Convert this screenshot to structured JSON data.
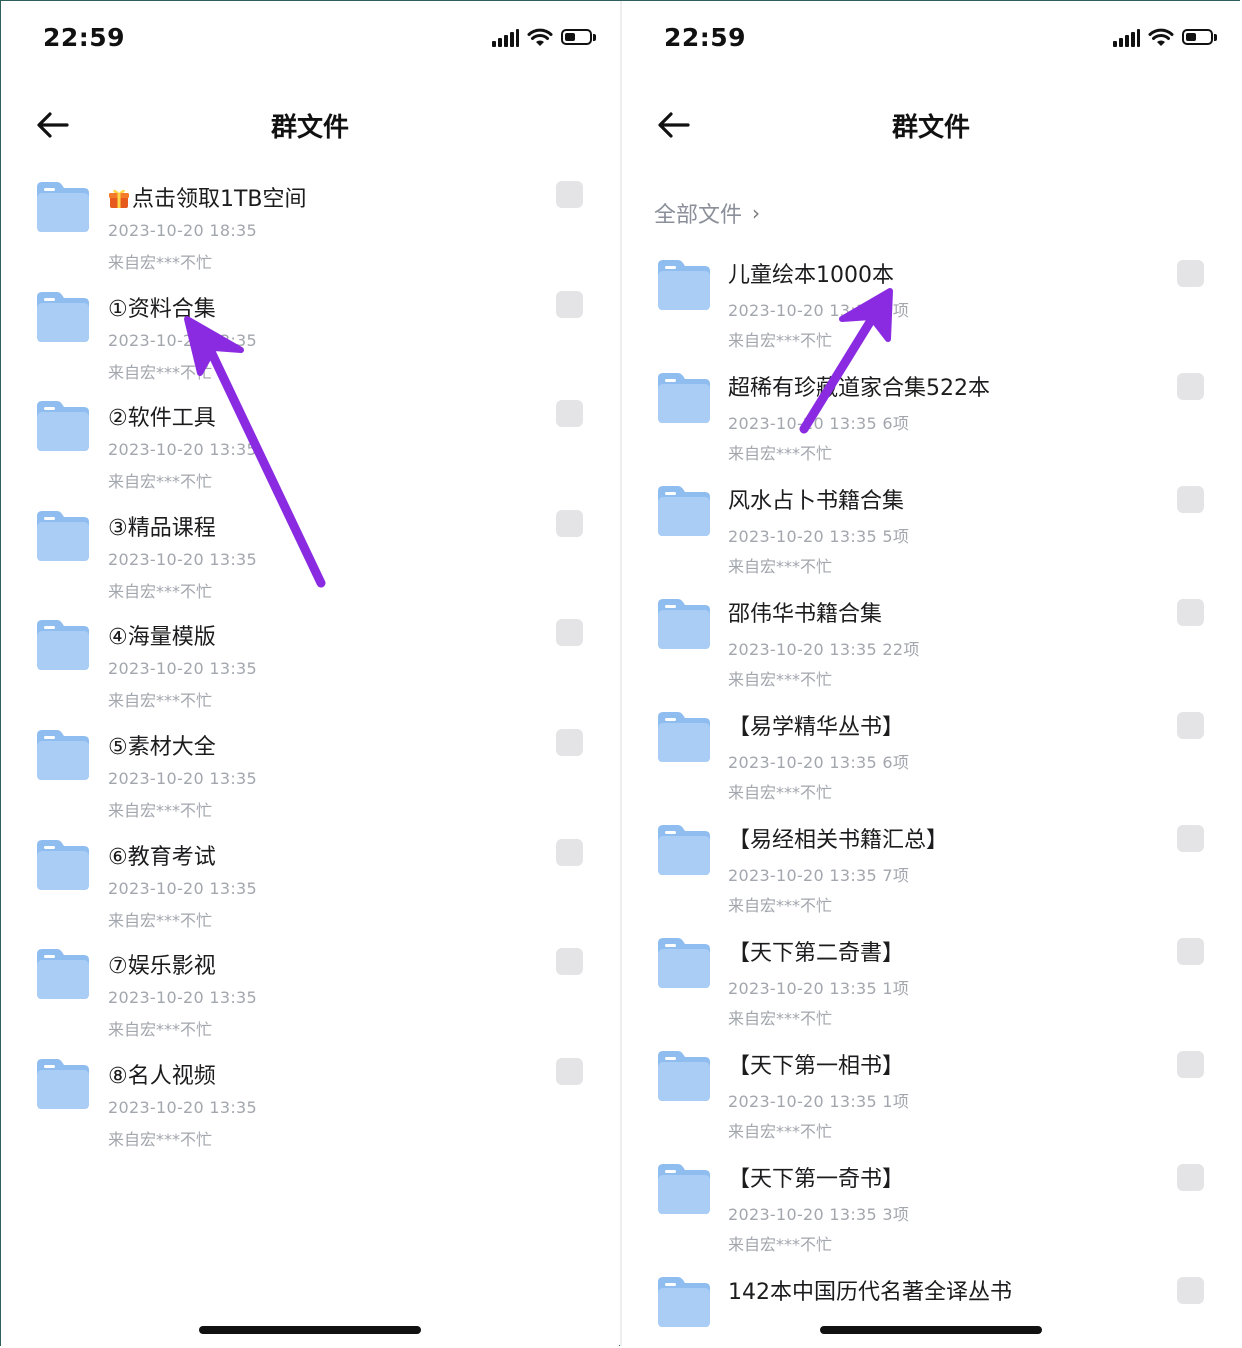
{
  "status": {
    "time": "22:59"
  },
  "left": {
    "title": "群文件",
    "items": [
      {
        "title": "点击领取1TB空间",
        "gift": true,
        "meta": "2023-10-20 18:35",
        "from": "来自宏***不忙"
      },
      {
        "title": "①资料合集",
        "meta": "2023-10-20 13:35",
        "from": "来自宏***不忙"
      },
      {
        "title": "②软件工具",
        "meta": "2023-10-20 13:35",
        "from": "来自宏***不忙"
      },
      {
        "title": "③精品课程",
        "meta": "2023-10-20 13:35",
        "from": "来自宏***不忙"
      },
      {
        "title": "④海量模版",
        "meta": "2023-10-20 13:35",
        "from": "来自宏***不忙"
      },
      {
        "title": "⑤素材大全",
        "meta": "2023-10-20 13:35",
        "from": "来自宏***不忙"
      },
      {
        "title": "⑥教育考试",
        "meta": "2023-10-20 13:35",
        "from": "来自宏***不忙"
      },
      {
        "title": "⑦娱乐影视",
        "meta": "2023-10-20 13:35",
        "from": "来自宏***不忙"
      },
      {
        "title": "⑧名人视频",
        "meta": "2023-10-20 13:35",
        "from": "来自宏***不忙"
      }
    ]
  },
  "right": {
    "title": "群文件",
    "breadcrumb": "全部文件",
    "items": [
      {
        "title": "儿童绘本1000本",
        "meta": "2023-10-20 13:35 3项",
        "from": "来自宏***不忙"
      },
      {
        "title": "超稀有珍藏道家合集522本",
        "meta": "2023-10-20 13:35 6项",
        "from": "来自宏***不忙"
      },
      {
        "title": "风水占卜书籍合集",
        "meta": "2023-10-20 13:35 5项",
        "from": "来自宏***不忙"
      },
      {
        "title": "邵伟华书籍合集",
        "meta": "2023-10-20 13:35 22项",
        "from": "来自宏***不忙"
      },
      {
        "title": "【易学精华丛书】",
        "meta": "2023-10-20 13:35 6项",
        "from": "来自宏***不忙"
      },
      {
        "title": "【易经相关书籍汇总】",
        "meta": "2023-10-20 13:35 7项",
        "from": "来自宏***不忙"
      },
      {
        "title": "【天下第二奇書】",
        "meta": "2023-10-20 13:35 1项",
        "from": "来自宏***不忙"
      },
      {
        "title": "【天下第一相书】",
        "meta": "2023-10-20 13:35 1项",
        "from": "来自宏***不忙"
      },
      {
        "title": "【天下第一奇书】",
        "meta": "2023-10-20 13:35 3项",
        "from": "来自宏***不忙"
      },
      {
        "title": "142本中国历代名著全译丛书",
        "meta": "",
        "from": ""
      }
    ]
  },
  "colors": {
    "arrow": "#8a2be2",
    "folder": "#a9cdf5",
    "folder_tab": "#8fbdf0"
  }
}
